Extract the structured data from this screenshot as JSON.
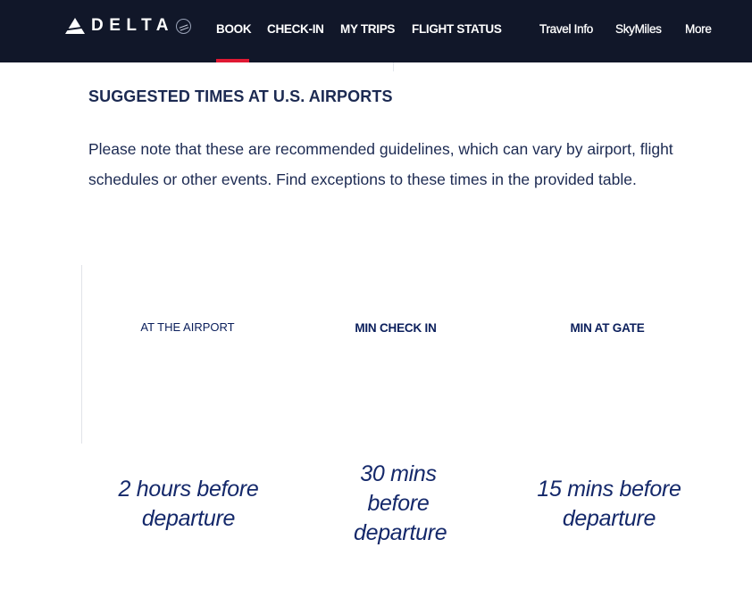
{
  "nav": {
    "brand": "DELTA",
    "primary": [
      "BOOK",
      "CHECK-IN",
      "MY TRIPS",
      "FLIGHT STATUS"
    ],
    "active": "BOOK",
    "secondary": [
      "Travel Info",
      "SkyMiles",
      "More"
    ],
    "accent_color": "#e01933",
    "background": "#111729"
  },
  "content": {
    "heading": "SUGGESTED TIMES AT U.S. AIRPORTS",
    "note": "Please note that these are recommended guidelines, which can vary by airport, flight schedules or other events. Find exceptions to these times in the provided table."
  },
  "times": [
    {
      "header": "AT THE AIRPORT",
      "value": "2 hours before departure"
    },
    {
      "header": "MIN CHECK IN",
      "value": "30 mins before departure"
    },
    {
      "header": "MIN AT GATE",
      "value": "15 mins before departure"
    }
  ]
}
